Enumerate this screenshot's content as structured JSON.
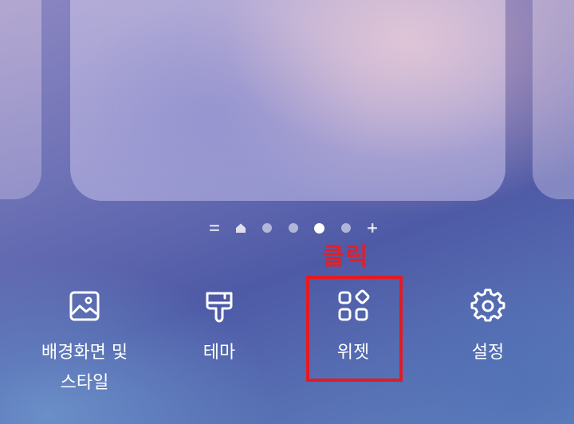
{
  "page_indicator": {
    "items": [
      "menu-lines-icon",
      "home-icon",
      "dot",
      "dot",
      "dot-active",
      "dot",
      "plus-icon"
    ],
    "active_index": 4
  },
  "annotation": {
    "label": "클릭",
    "color": "#e0202a"
  },
  "menu": {
    "items": [
      {
        "id": "wallpaper",
        "icon": "image-icon",
        "line1": "배경화면 및",
        "line2": "스타일"
      },
      {
        "id": "theme",
        "icon": "brush-icon",
        "line1": "테마",
        "line2": ""
      },
      {
        "id": "widget",
        "icon": "widgets-icon",
        "line1": "위젯",
        "line2": ""
      },
      {
        "id": "settings",
        "icon": "gear-icon",
        "line1": "설정",
        "line2": ""
      }
    ]
  }
}
